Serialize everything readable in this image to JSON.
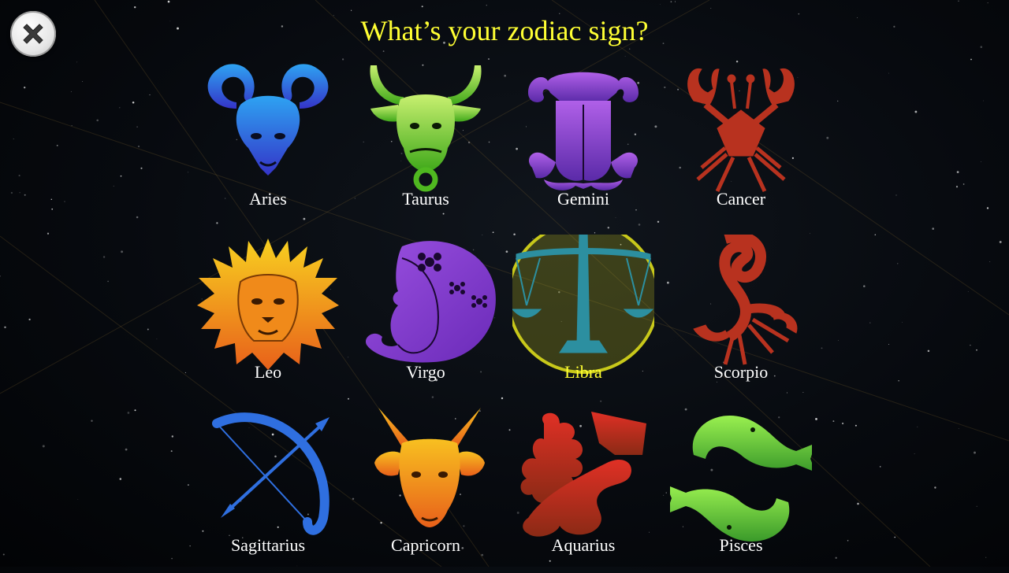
{
  "title": "What’s your zodiac sign?",
  "close_icon": "close-icon",
  "selected_sign": "Libra",
  "colors": {
    "title": "#ffff33",
    "label": "#ffffff",
    "selected_label": "#ffff33",
    "selection_ring": "#c8c81a"
  },
  "signs": [
    {
      "label": "Aries",
      "icon": "ram-icon",
      "color": "#2f6fe0"
    },
    {
      "label": "Taurus",
      "icon": "bull-icon",
      "color": "#7fd12a"
    },
    {
      "label": "Gemini",
      "icon": "twins-icon",
      "color": "#8a3fd0"
    },
    {
      "label": "Cancer",
      "icon": "crab-icon",
      "color": "#b8321f"
    },
    {
      "label": "Leo",
      "icon": "lion-icon",
      "color": "#f08a1a"
    },
    {
      "label": "Virgo",
      "icon": "maiden-icon",
      "color": "#8a3fd0"
    },
    {
      "label": "Libra",
      "icon": "scales-icon",
      "color": "#2c8fa0"
    },
    {
      "label": "Scorpio",
      "icon": "scorpion-icon",
      "color": "#b8321f"
    },
    {
      "label": "Sagittarius",
      "icon": "bow-arrow-icon",
      "color": "#2f6fe0"
    },
    {
      "label": "Capricorn",
      "icon": "goat-icon",
      "color": "#f08a1a"
    },
    {
      "label": "Aquarius",
      "icon": "water-bearer-icon",
      "color": "#c0301f"
    },
    {
      "label": "Pisces",
      "icon": "fish-icon",
      "color": "#6fd03a"
    }
  ]
}
